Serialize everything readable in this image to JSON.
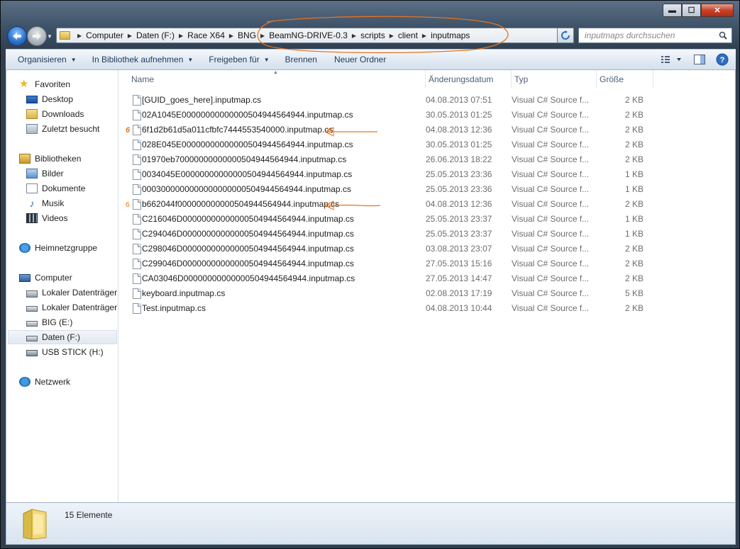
{
  "window": {
    "controls": {
      "minimize": "▬",
      "maximize": "☐",
      "close": "✕"
    }
  },
  "address": {
    "crumbs": [
      "Computer",
      "Daten (F:)",
      "Race X64",
      "BNG",
      "BeamNG-DRIVE-0.3",
      "scripts",
      "client",
      "inputmaps"
    ]
  },
  "search": {
    "placeholder": "inputmaps durchsuchen"
  },
  "toolbar": {
    "organize": "Organisieren",
    "include_library": "In Bibliothek aufnehmen",
    "share": "Freigeben für",
    "burn": "Brennen",
    "new_folder": "Neuer Ordner"
  },
  "sidebar": {
    "favorites": "Favoriten",
    "desktop": "Desktop",
    "downloads": "Downloads",
    "recent": "Zuletzt besucht",
    "libraries": "Bibliotheken",
    "pictures": "Bilder",
    "documents": "Dokumente",
    "music": "Musik",
    "videos": "Videos",
    "homegroup": "Heimnetzgruppe",
    "computer": "Computer",
    "local1": "Lokaler Datenträger",
    "local2": "Lokaler Datenträger",
    "big": "BIG (E:)",
    "daten": "Daten (F:)",
    "usb": "USB STICK (H:)",
    "network": "Netzwerk"
  },
  "columns": {
    "name": "Name",
    "date": "Änderungsdatum",
    "type": "Typ",
    "size": "Größe"
  },
  "files": [
    {
      "name": "[GUID_goes_here].inputmap.cs",
      "date": "04.08.2013 07:51",
      "type": "Visual C# Source f...",
      "size": "2 KB"
    },
    {
      "name": "02A1045E00000000000000504944564944.inputmap.cs",
      "date": "30.05.2013 01:25",
      "type": "Visual C# Source f...",
      "size": "2 KB"
    },
    {
      "name": "6f1d2b61d5a011cfbfc7444553540000.inputmap.cs",
      "date": "04.08.2013 12:36",
      "type": "Visual C# Source f...",
      "size": "2 KB"
    },
    {
      "name": "028E045E00000000000000504944564944.inputmap.cs",
      "date": "30.05.2013 01:25",
      "type": "Visual C# Source f...",
      "size": "2 KB"
    },
    {
      "name": "01970eb70000000000000504944564944.inputmap.cs",
      "date": "26.06.2013 18:22",
      "type": "Visual C# Source f...",
      "size": "2 KB"
    },
    {
      "name": "0034045E00000000000000504944564944.inputmap.cs",
      "date": "25.05.2013 23:36",
      "type": "Visual C# Source f...",
      "size": "1 KB"
    },
    {
      "name": "0003000000000000000000504944564944.inputmap.cs",
      "date": "25.05.2013 23:36",
      "type": "Visual C# Source f...",
      "size": "1 KB"
    },
    {
      "name": "b662044f000000000000504944564944.inputmap.cs",
      "date": "04.08.2013 12:36",
      "type": "Visual C# Source f...",
      "size": "2 KB"
    },
    {
      "name": "C216046D00000000000000504944564944.inputmap.cs",
      "date": "25.05.2013 23:37",
      "type": "Visual C# Source f...",
      "size": "1 KB"
    },
    {
      "name": "C294046D00000000000000504944564944.inputmap.cs",
      "date": "25.05.2013 23:37",
      "type": "Visual C# Source f...",
      "size": "1 KB"
    },
    {
      "name": "C298046D00000000000000504944564944.inputmap.cs",
      "date": "03.08.2013 23:07",
      "type": "Visual C# Source f...",
      "size": "2 KB"
    },
    {
      "name": "C299046D00000000000000504944564944.inputmap.cs",
      "date": "27.05.2013 15:16",
      "type": "Visual C# Source f...",
      "size": "2 KB"
    },
    {
      "name": "CA03046D00000000000000504944564944.inputmap.cs",
      "date": "27.05.2013 14:47",
      "type": "Visual C# Source f...",
      "size": "2 KB"
    },
    {
      "name": "keyboard.inputmap.cs",
      "date": "02.08.2013 17:19",
      "type": "Visual C# Source f...",
      "size": "5 KB"
    },
    {
      "name": "Test.inputmap.cs",
      "date": "04.08.2013 10:44",
      "type": "Visual C# Source f...",
      "size": "2 KB"
    }
  ],
  "annotations": {
    "mark1": "6",
    "mark2": "6",
    "color": "#e8731f"
  },
  "status": {
    "count": "15 Elemente"
  }
}
